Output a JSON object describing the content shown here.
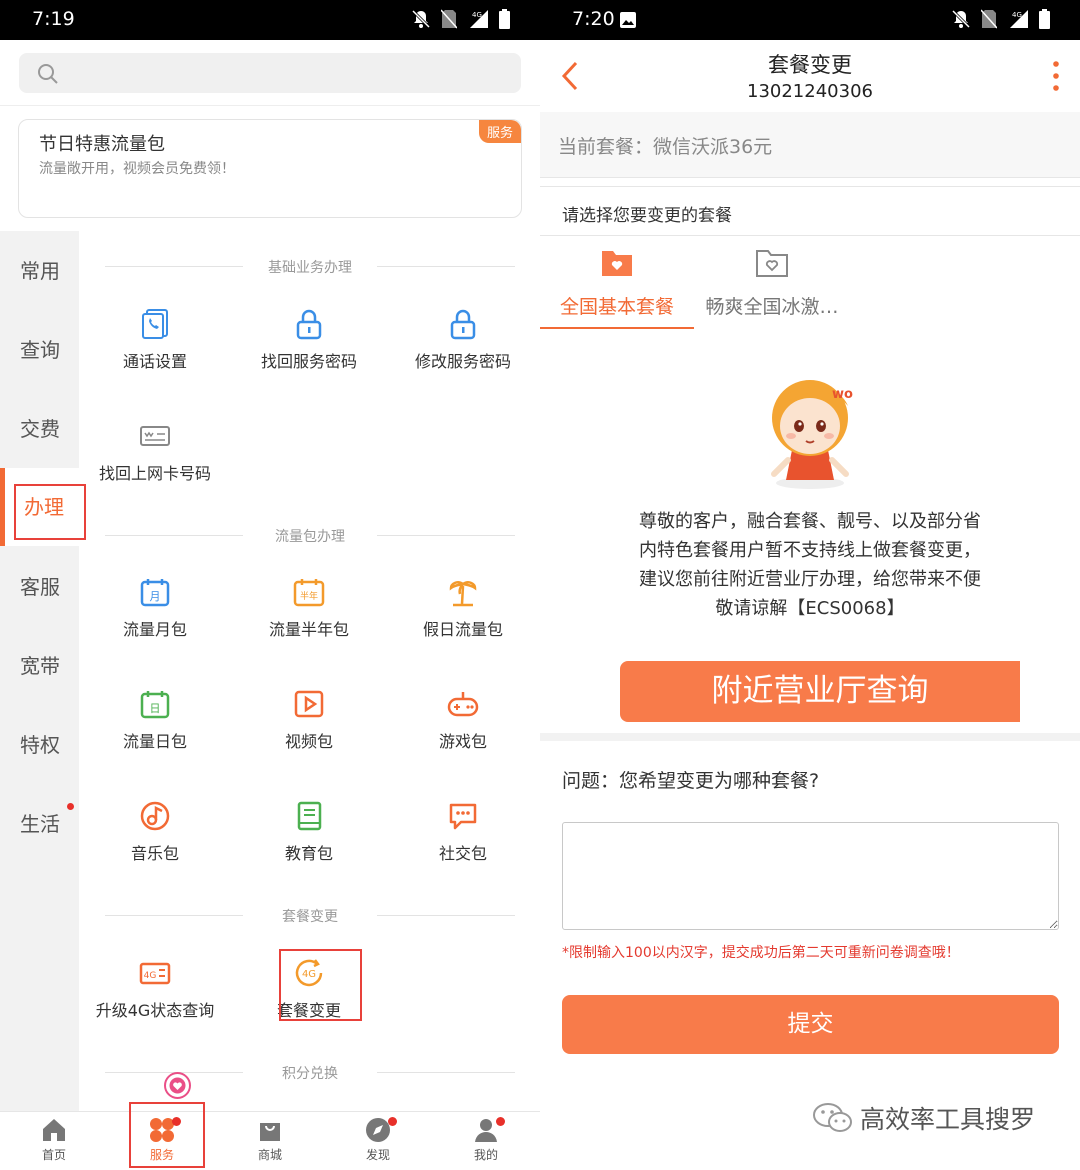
{
  "left": {
    "status_time": "7:19",
    "promo": {
      "title": "节日特惠流量包",
      "subtitle": "流量敞开用，视频会员免费领！",
      "badge": "服务"
    },
    "sidebar": [
      "常用",
      "查询",
      "交费",
      "办理",
      "客服",
      "宽带",
      "特权",
      "生活"
    ],
    "sections": {
      "basic": "基础业务办理",
      "data_pack": "流量包办理",
      "plan_change": "套餐变更",
      "points": "积分兑换"
    },
    "basic_items": [
      "通话设置",
      "找回服务密码",
      "修改服务密码",
      "找回上网卡号码"
    ],
    "data_items": [
      "流量月包",
      "流量半年包",
      "假日流量包",
      "流量日包",
      "视频包",
      "游戏包",
      "音乐包",
      "教育包",
      "社交包"
    ],
    "data_icon_text": {
      "month": "月",
      "half_year": "半年",
      "day": "日"
    },
    "change_items": [
      "升级4G状态查询",
      "套餐变更"
    ],
    "change_icon_text": {
      "upgrade": "4G",
      "plan": "4G"
    },
    "tabbar": [
      "首页",
      "服务",
      "商城",
      "发现",
      "我的"
    ],
    "colors": {
      "accent": "#f26a35",
      "icon_blue": "#3a8ee6",
      "icon_orange": "#f39a2b",
      "icon_green": "#4cb050",
      "highlight_red": "#e8413a"
    }
  },
  "right": {
    "status_time": "7:20",
    "title": "套餐变更",
    "phone": "13021240306",
    "current_plan": "当前套餐：微信沃派36元",
    "select_hint": "请选择您要变更的套餐",
    "plan_tabs": [
      "全国基本套餐",
      "畅爽全国冰激…"
    ],
    "mascot_mark": "wo",
    "notice": [
      "尊敬的客户，融合套餐、靓号、以及部分省",
      "内特色套餐用户暂不支持线上做套餐变更，",
      "建议您前往附近营业厅办理，给您带来不便",
      "敬请谅解【ECS0068】"
    ],
    "nearby_button": "附近营业厅查询",
    "question": "问题：您希望变更为哪种套餐?",
    "limit_note": "*限制输入100以内汉字，提交成功后第二天可重新问卷调查哦！",
    "submit_button": "提交",
    "watermark": "高效率工具搜罗",
    "colors": {
      "button": "#f87b4a",
      "accent": "#f26a35",
      "warning": "#e43a2f"
    }
  }
}
